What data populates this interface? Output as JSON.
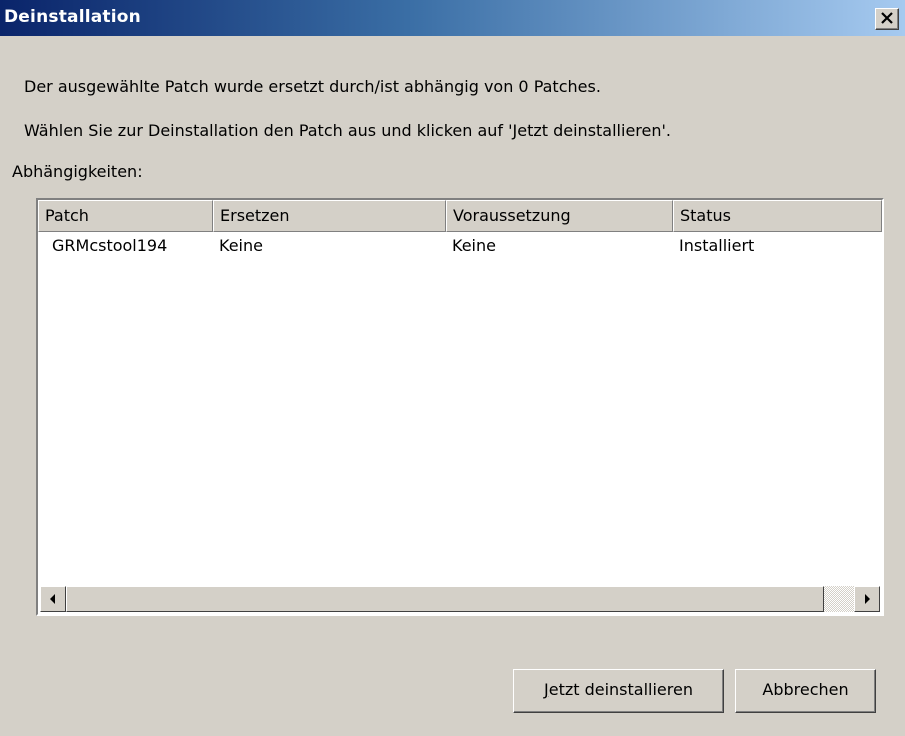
{
  "window": {
    "title": "Deinstallation",
    "close_icon": "close-icon"
  },
  "messages": {
    "line1": "Der ausgewählte Patch wurde ersetzt durch/ist abhängig von 0 Patches.",
    "line2": "Wählen Sie zur Deinstallation den Patch aus und klicken auf 'Jetzt deinstallieren'.",
    "dependencies_label": "Abhängigkeiten:"
  },
  "table": {
    "columns": [
      "Patch",
      "Ersetzen",
      "Voraussetzung",
      "Status"
    ],
    "rows": [
      [
        "GRMcstool194",
        "Keine",
        "Keine",
        "Installiert"
      ]
    ]
  },
  "scrollbar": {
    "left_icon": "arrow-left-icon",
    "right_icon": "arrow-right-icon"
  },
  "buttons": {
    "uninstall_mnemonic": "J",
    "uninstall_rest": "etzt deinstallieren",
    "cancel": "Abbrechen"
  }
}
